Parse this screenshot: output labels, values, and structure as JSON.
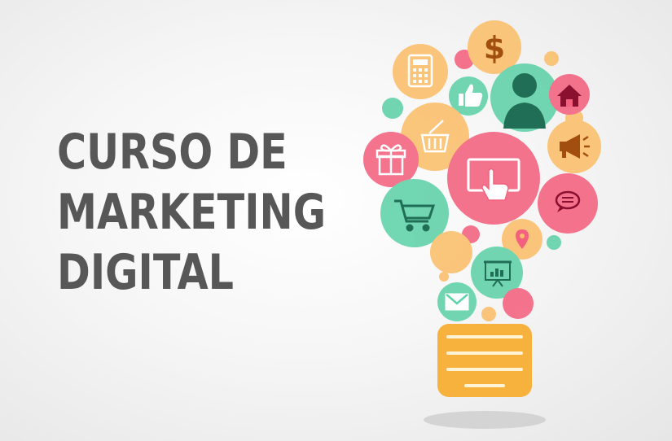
{
  "title": {
    "lines": [
      "CURSO DE",
      "MARKETING",
      "DIGITAL"
    ]
  },
  "illustration": {
    "icons": [
      "dollar-icon",
      "calculator-icon",
      "thumbs-up-icon",
      "user-icon",
      "home-icon",
      "shopping-basket-icon",
      "gift-icon",
      "touchscreen-icon",
      "megaphone-icon",
      "shopping-cart-icon",
      "chat-bubble-icon",
      "location-pin-icon",
      "presentation-board-icon",
      "envelope-icon"
    ],
    "colors": {
      "orange": "#fbbf6a",
      "pink": "#f4617e",
      "teal": "#5fd1a8",
      "bulb_base": "#f7b13d",
      "text": "#575757",
      "shadow": "#cfcfcf"
    }
  }
}
